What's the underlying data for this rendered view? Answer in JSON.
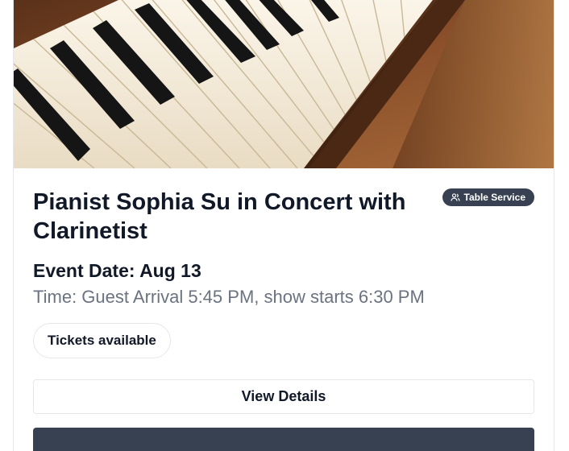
{
  "event": {
    "title": "Pianist Sophia Su in Concert with Clarinetist",
    "badge_label": "Table Service",
    "badge_icon": "users-icon",
    "date": "Event Date: Aug 13",
    "time": "Time: Guest Arrival 5:45 PM, show starts 6:30 PM",
    "availability": "Tickets available"
  },
  "actions": {
    "view_details_label": "View Details"
  },
  "image": {
    "subject": "piano-keyboard"
  },
  "colors": {
    "badge_bg": "#374151",
    "title_text": "#111827",
    "muted_text": "#6b7280",
    "border": "#e5e7eb",
    "wood": "#7a4526"
  }
}
